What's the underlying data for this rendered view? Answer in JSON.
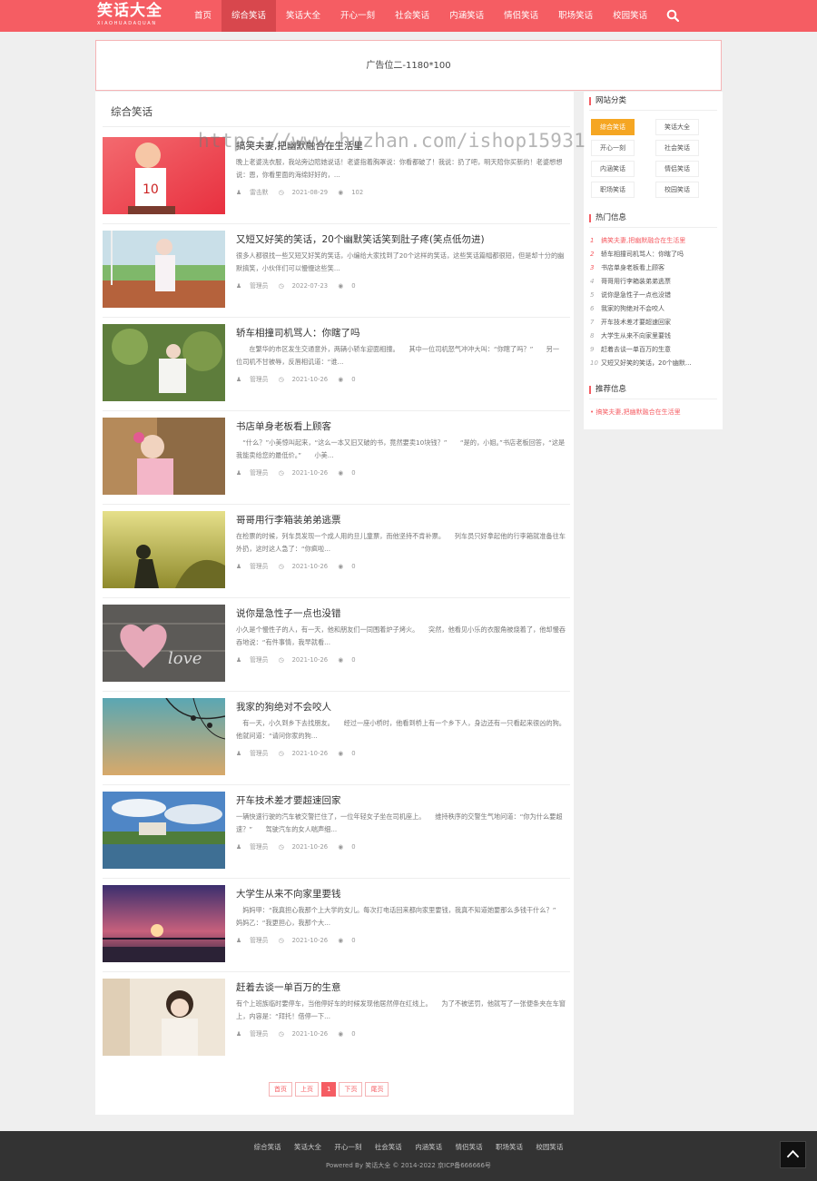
{
  "header": {
    "logo": "笑话大全",
    "logo_sub": "XIAOHUADAQUAN",
    "nav": [
      "首页",
      "综合笑话",
      "笑话大全",
      "开心一刻",
      "社会笑话",
      "内涵笑话",
      "情侣笑话",
      "职场笑话",
      "校园笑话"
    ],
    "active_index": 1
  },
  "ad": "广告位二-1180*100",
  "main": {
    "heading": "综合笑话",
    "articles": [
      {
        "title": "搞笑夫妻,把幽默融合在生活里",
        "desc": "晚上老婆洗衣服，我站旁边陪她说话！老婆指着胸罩说：你看都破了！我说：扔了吧，明天陪你买新的！老婆想想说：恩，你看里面的海绵好好的，...",
        "author": "雷击默",
        "date": "2021-08-29",
        "views": "102"
      },
      {
        "title": "又短又好笑的笑话，20个幽默笑话笑到肚子疼(笑点低勿进)",
        "desc": "很多人都很找一些又短又好笑的笑话，小编给大家找到了20个这样的笑话，这些笑话篇幅都很短，但是却十分的幽默搞笑，小伙伴们可以慢慢这些笑...",
        "author": "管理员",
        "date": "2022-07-23",
        "views": "0"
      },
      {
        "title": "轿车相撞司机骂人：你瞎了吗",
        "desc": "　　在繁华的市区发生交通意外，两辆小轿车迎面相撞。　　其中一位司机怒气冲冲大叫：“你瞎了吗？”　　另一位司机不甘被辱，反唇相讥道：“谁...",
        "author": "管理员",
        "date": "2021-10-26",
        "views": "0"
      },
      {
        "title": "书店单身老板看上顾客",
        "desc": "　“什么？”小美惊叫起来，“这么一本又旧又破的书，竟然要卖10块钱？”　　“是的，小姐。”书店老板回答，“这是我能卖给您的最低价。”　　小美...",
        "author": "管理员",
        "date": "2021-10-26",
        "views": "0"
      },
      {
        "title": "哥哥用行李箱装弟弟逃票",
        "desc": "在检票的时候，列车员发现一个成人用的旦儿童票，而他坚持不肯补票。　　列车员只好拿起他的行李箱就准备往车外扔，这时这人急了：“你疯啦...",
        "author": "管理员",
        "date": "2021-10-26",
        "views": "0"
      },
      {
        "title": "说你是急性子一点也没错",
        "desc": "小久是个慢性子的人，有一天，他和朋友们一同围着炉子烤火。　　突然，他看见小乐的衣服角被烧着了，他却慢吞吞地说：“有件事情，我早就看...",
        "author": "管理员",
        "date": "2021-10-26",
        "views": "0"
      },
      {
        "title": "我家的狗绝对不会咬人",
        "desc": "　有一天，小久到乡下去找朋友。　　经过一座小桥时，他看到桥上有一个乡下人，身边还有一只看起来很凶的狗。　　他就问道：“请问你家的狗...",
        "author": "管理员",
        "date": "2021-10-26",
        "views": "0"
      },
      {
        "title": "开车技术差才要超速回家",
        "desc": "一辆快速行驶的汽车被交警拦住了，一位年轻女子坐在司机座上。　　维持秩序的交警生气地问道：“你为什么要超速？”　　驾驶汽车的女人喘声细...",
        "author": "管理员",
        "date": "2021-10-26",
        "views": "0"
      },
      {
        "title": "大学生从来不向家里要钱",
        "desc": "　妈妈甲：“我真担心我那个上大学的女儿。每次打电话回来都向家里要钱，我真不知道她要那么多钱干什么？”　　妈妈乙：“我更担心，我那个大...",
        "author": "管理员",
        "date": "2021-10-26",
        "views": "0"
      },
      {
        "title": "赶着去谈一单百万的生意",
        "desc": "有个上班族临时要停车，当他停好车的时候发现他居然停在红线上。　　为了不被惩罚，他就写了一张便条夹在车窗上，内容是：“拜托！借停一下...",
        "author": "管理员",
        "date": "2021-10-26",
        "views": "0"
      }
    ],
    "pager": [
      "首页",
      "上页",
      "1",
      "下页",
      "尾页"
    ]
  },
  "sidebar": {
    "cat_title": "网站分类",
    "categories": [
      "综合笑话",
      "笑话大全",
      "开心一刻",
      "社会笑话",
      "内涵笑话",
      "情侣笑话",
      "职场笑话",
      "校园笑话"
    ],
    "hot_title": "热门信息",
    "hot": [
      "搞笑夫妻,把幽默融合在生活里",
      "轿车相撞司机骂人：你瞎了吗",
      "书店单身老板看上顾客",
      "哥哥用行李箱装弟弟逃票",
      "说你是急性子一点也没错",
      "我家的狗绝对不会咬人",
      "开车技术差才要超速回家",
      "大学生从来不向家里要钱",
      "赶着去谈一单百万的生意",
      "又短又好笑的笑话，20个幽默..."
    ],
    "rec_title": "推荐信息",
    "rec": [
      "搞笑夫妻,把幽默融合在生活里"
    ]
  },
  "footer": {
    "links": [
      "综合笑话",
      "笑话大全",
      "开心一刻",
      "社会笑话",
      "内涵笑话",
      "情侣笑话",
      "职场笑话",
      "校园笑话"
    ],
    "copyright": "Powered By 笑话大全 © 2014-2022 京ICP备666666号"
  },
  "watermark": "https://www.huzhan.com/ishop15931",
  "colors": {
    "accent": "#f55d63",
    "category_active": "#f5a623",
    "footer_bg": "#333333"
  }
}
